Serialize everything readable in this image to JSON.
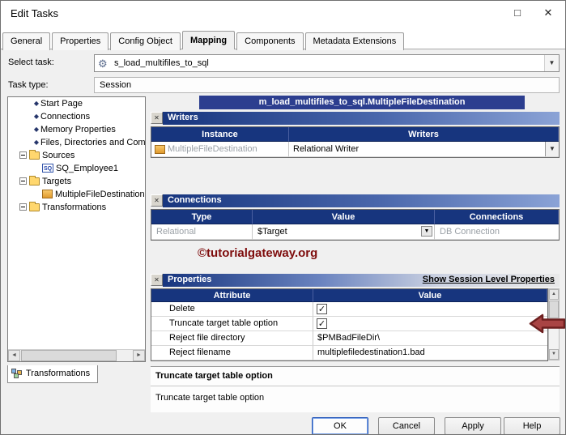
{
  "window": {
    "title": "Edit Tasks"
  },
  "tabs": [
    "General",
    "Properties",
    "Config Object",
    "Mapping",
    "Components",
    "Metadata Extensions"
  ],
  "task": {
    "select_label": "Select task:",
    "select_value": "s_load_multifiles_to_sql",
    "type_label": "Task type:",
    "type_value": "Session"
  },
  "tree": {
    "items": [
      "Start Page",
      "Connections",
      "Memory Properties",
      "Files, Directories and Com",
      "Sources",
      "SQ_Employee1",
      "Targets",
      "MultipleFileDestination",
      "Transformations"
    ],
    "bottom_tab": "Transformations"
  },
  "main": {
    "header": "m_load_multifiles_to_sql.MultipleFileDestination",
    "writers": {
      "title": "Writers",
      "columns": [
        "Instance",
        "Writers"
      ],
      "rows": [
        {
          "instance": "MultipleFileDestination",
          "writer": "Relational Writer"
        }
      ]
    },
    "connections": {
      "title": "Connections",
      "columns": [
        "Type",
        "Value",
        "Connections"
      ],
      "rows": [
        {
          "type": "Relational",
          "value": "$Target",
          "connection": "DB Connection"
        }
      ]
    },
    "watermark": "©tutorialgateway.org",
    "properties": {
      "title": "Properties",
      "link": "Show Session Level Properties",
      "columns": [
        "Attribute",
        "Value"
      ],
      "rows": [
        {
          "attribute": "Delete",
          "checked": true
        },
        {
          "attribute": "Truncate target table option",
          "checked": true
        },
        {
          "attribute": "Reject file directory",
          "value": "$PMBadFileDir\\"
        },
        {
          "attribute": "Reject filename",
          "value": "multiplefiledestination1.bad"
        }
      ]
    },
    "description": {
      "title": "Truncate target table option",
      "body": "Truncate target table option"
    }
  },
  "buttons": {
    "ok": "OK",
    "cancel": "Cancel",
    "apply": "Apply",
    "help": "Help"
  }
}
